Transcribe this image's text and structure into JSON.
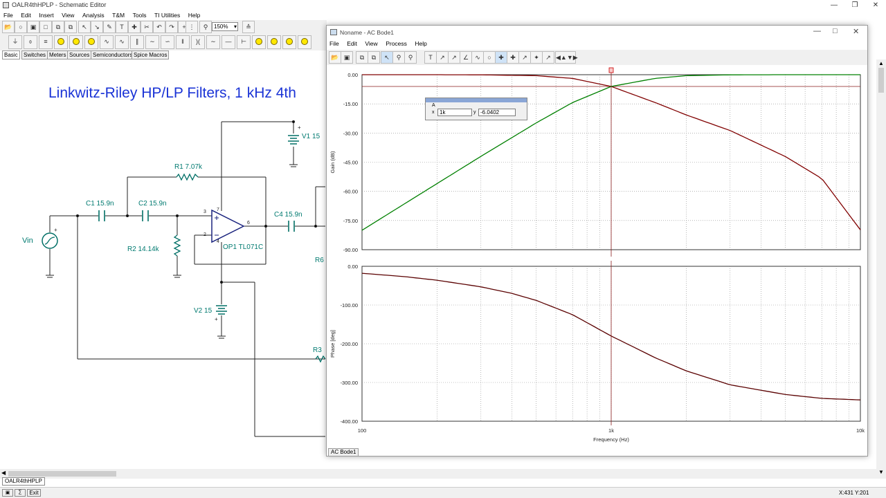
{
  "app": {
    "title": "OALR4thHPLP - Schematic Editor",
    "menu": [
      "File",
      "Edit",
      "Insert",
      "View",
      "Analysis",
      "T&M",
      "Tools",
      "TI Utilities",
      "Help"
    ],
    "zoom": "150%",
    "component_tabs": [
      "Basic",
      "Switches",
      "Meters",
      "Sources",
      "Semiconductors",
      "Spice Macros"
    ],
    "bottom_tab": "OALR4thHPLP",
    "status_buttons": [
      "Exit"
    ],
    "coords": "X:431  Y:201"
  },
  "schematic": {
    "title": "Linkwitz-Riley HP/LP Filters, 1 kHz 4th",
    "labels": {
      "vin": "Vin",
      "c1": "C1 15.9n",
      "c2": "C2 15.9n",
      "r1": "R1 7.07k",
      "r2": "R2 14.14k",
      "v1": "V1 15",
      "v2": "V2 15",
      "op1": "OP1 TL071C",
      "c4": "C4 15.9n",
      "r6": "R6",
      "r3": "R3",
      "pin3": "3",
      "pin2": "2",
      "pin6": "6",
      "pin7": "7",
      "pin4": "4"
    }
  },
  "bode_window": {
    "title": "Noname - AC Bode1",
    "menu": [
      "File",
      "Edit",
      "View",
      "Process",
      "Help"
    ],
    "tab": "AC Bode1",
    "cursor": {
      "name": "A",
      "x_label": "x",
      "x_value": "1k",
      "y_label": "y",
      "y_value": "-6.0402"
    }
  },
  "chart_data": [
    {
      "type": "line",
      "ylabel": "Gain (dB)",
      "xlabel": "",
      "xscale": "log",
      "xlim": [
        100,
        10000
      ],
      "ylim": [
        -90,
        0
      ],
      "yticks": [
        "0.00",
        "-15.00",
        "-30.00",
        "-45.00",
        "-60.00",
        "-75.00",
        "-90.00"
      ],
      "grid": true,
      "series": [
        {
          "color": "#800000",
          "x": [
            100,
            200,
            300,
            500,
            700,
            1000,
            1500,
            2000,
            3000,
            5000,
            7000,
            10000
          ],
          "y": [
            0,
            -0.01,
            -0.07,
            -0.5,
            -1.9,
            -6.04,
            -14.3,
            -20.7,
            -28.7,
            -42.1,
            -53.4,
            -79.8
          ]
        },
        {
          "color": "#008000",
          "x": [
            100,
            200,
            300,
            500,
            700,
            1000,
            1500,
            2000,
            3000,
            5000,
            7000,
            10000
          ],
          "y": [
            -80,
            -56,
            -42,
            -24.8,
            -14.3,
            -6.04,
            -1.9,
            -0.5,
            -0.07,
            0,
            0,
            0
          ]
        }
      ],
      "hline": -6.0402
    },
    {
      "type": "line",
      "ylabel": "Phase [deg]",
      "xlabel": "Frequency (Hz)",
      "xscale": "log",
      "xlim": [
        100,
        10000
      ],
      "ylim": [
        -400,
        0
      ],
      "yticks": [
        "0.00",
        "-100.00",
        "-200.00",
        "-300.00",
        "-400.00"
      ],
      "xticks": [
        "100",
        "1k",
        "10k"
      ],
      "grid": true,
      "series": [
        {
          "color": "#5a0000",
          "x": [
            100,
            150,
            200,
            300,
            400,
            500,
            700,
            1000,
            1500,
            2000,
            3000,
            5000,
            7000,
            10000
          ],
          "y": [
            -18,
            -27,
            -36,
            -53,
            -70,
            -88,
            -125,
            -180,
            -236,
            -270,
            -306,
            -331,
            -341,
            -345
          ]
        }
      ]
    }
  ]
}
